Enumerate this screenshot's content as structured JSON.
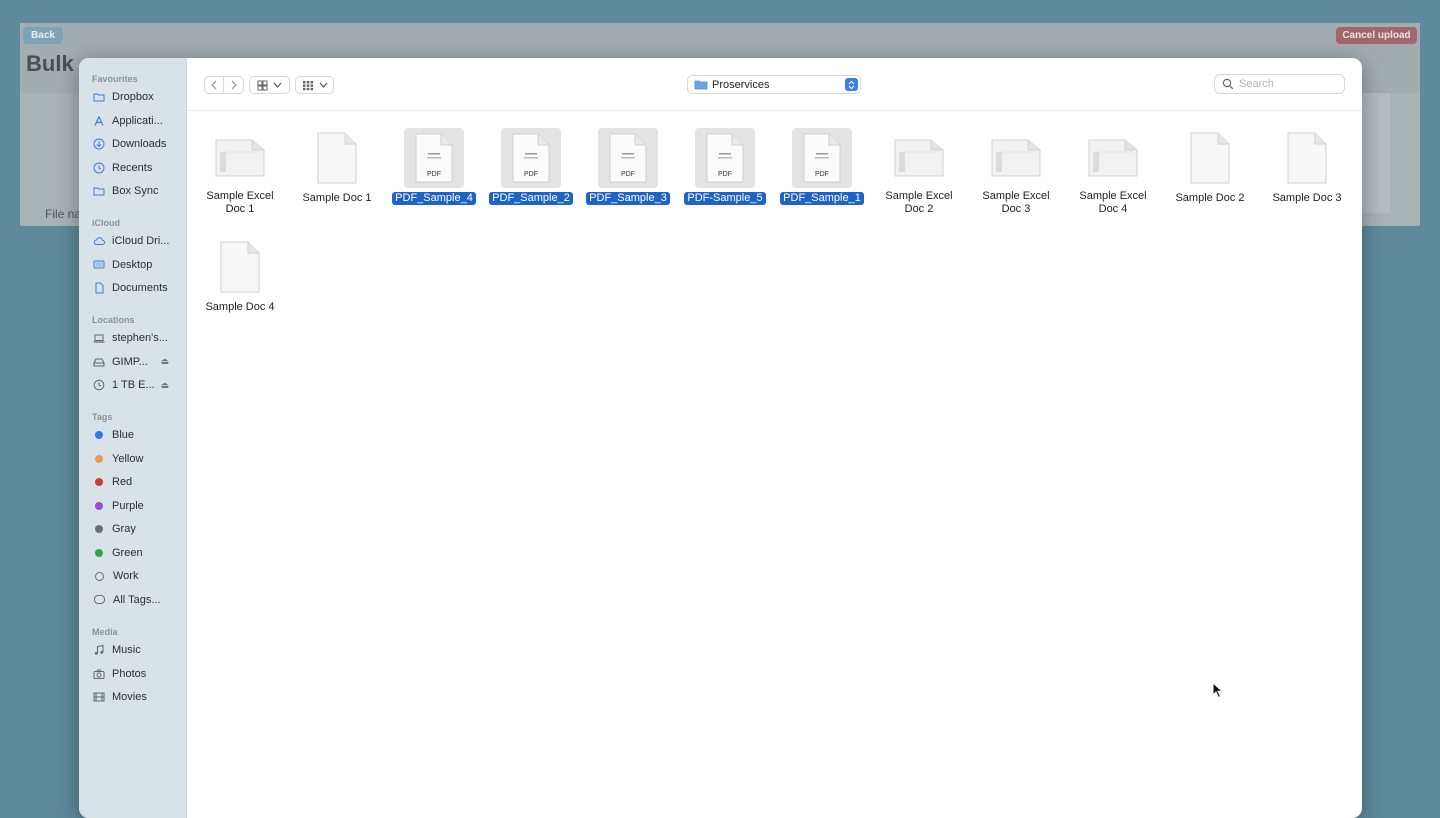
{
  "background_app": {
    "back_label": "Back",
    "cancel_label": "Cancel upload",
    "title": "Bulk",
    "file_label": "File na"
  },
  "sidebar": {
    "favourites_heading": "Favourites",
    "favourites": [
      {
        "label": "Dropbox",
        "icon": "folder-icon"
      },
      {
        "label": "Applicati...",
        "icon": "applications-icon"
      },
      {
        "label": "Downloads",
        "icon": "downloads-icon"
      },
      {
        "label": "Recents",
        "icon": "clock-icon"
      },
      {
        "label": "Box Sync",
        "icon": "folder-icon"
      }
    ],
    "icloud_heading": "iCloud",
    "icloud": [
      {
        "label": "iCloud Dri...",
        "icon": "cloud-icon"
      },
      {
        "label": "Desktop",
        "icon": "desktop-icon"
      },
      {
        "label": "Documents",
        "icon": "document-icon"
      }
    ],
    "locations_heading": "Locations",
    "locations": [
      {
        "label": "stephen's...",
        "icon": "laptop-icon"
      },
      {
        "label": "GIMP...",
        "icon": "disk-icon",
        "eject": "⏏"
      },
      {
        "label": "1 TB E...",
        "icon": "time-machine-icon",
        "eject": "⏏"
      }
    ],
    "tags_heading": "Tags",
    "tags": [
      {
        "label": "Blue",
        "color": "#2a7be4"
      },
      {
        "label": "Yellow",
        "color": "#e39a5a"
      },
      {
        "label": "Red",
        "color": "#d33a3a"
      },
      {
        "label": "Purple",
        "color": "#9a4fc7"
      },
      {
        "label": "Gray",
        "color": "#6e6e6e"
      },
      {
        "label": "Green",
        "color": "#2aa845"
      },
      {
        "label": "Work",
        "color": "outline"
      },
      {
        "label": "All Tags...",
        "color": "alltags"
      }
    ],
    "media_heading": "Media",
    "media": [
      {
        "label": "Music",
        "icon": "music-icon"
      },
      {
        "label": "Photos",
        "icon": "camera-icon"
      },
      {
        "label": "Movies",
        "icon": "film-icon"
      }
    ]
  },
  "toolbar": {
    "current_folder": "Proservices",
    "search_placeholder": "Search"
  },
  "files": [
    {
      "name": "Sample Excel Doc 1",
      "kind": "excel",
      "selected": false
    },
    {
      "name": "Sample Doc 1",
      "kind": "doc",
      "selected": false
    },
    {
      "name": "PDF_Sample_4",
      "kind": "pdf",
      "selected": true
    },
    {
      "name": "PDF_Sample_2",
      "kind": "pdf",
      "selected": true
    },
    {
      "name": "PDF_Sample_3",
      "kind": "pdf",
      "selected": true
    },
    {
      "name": "PDF-Sample_5",
      "kind": "pdf",
      "selected": true
    },
    {
      "name": "PDF_Sample_1",
      "kind": "pdf",
      "selected": true
    },
    {
      "name": "Sample Excel Doc 2",
      "kind": "excel",
      "selected": false
    },
    {
      "name": "Sample Excel Doc 3",
      "kind": "excel",
      "selected": false
    },
    {
      "name": "Sample Excel Doc 4",
      "kind": "excel",
      "selected": false
    },
    {
      "name": "Sample Doc 2",
      "kind": "doc",
      "selected": false
    },
    {
      "name": "Sample Doc 3",
      "kind": "doc",
      "selected": false
    },
    {
      "name": "Sample Doc 4",
      "kind": "doc",
      "selected": false
    }
  ],
  "pdf_badge": "PDF"
}
